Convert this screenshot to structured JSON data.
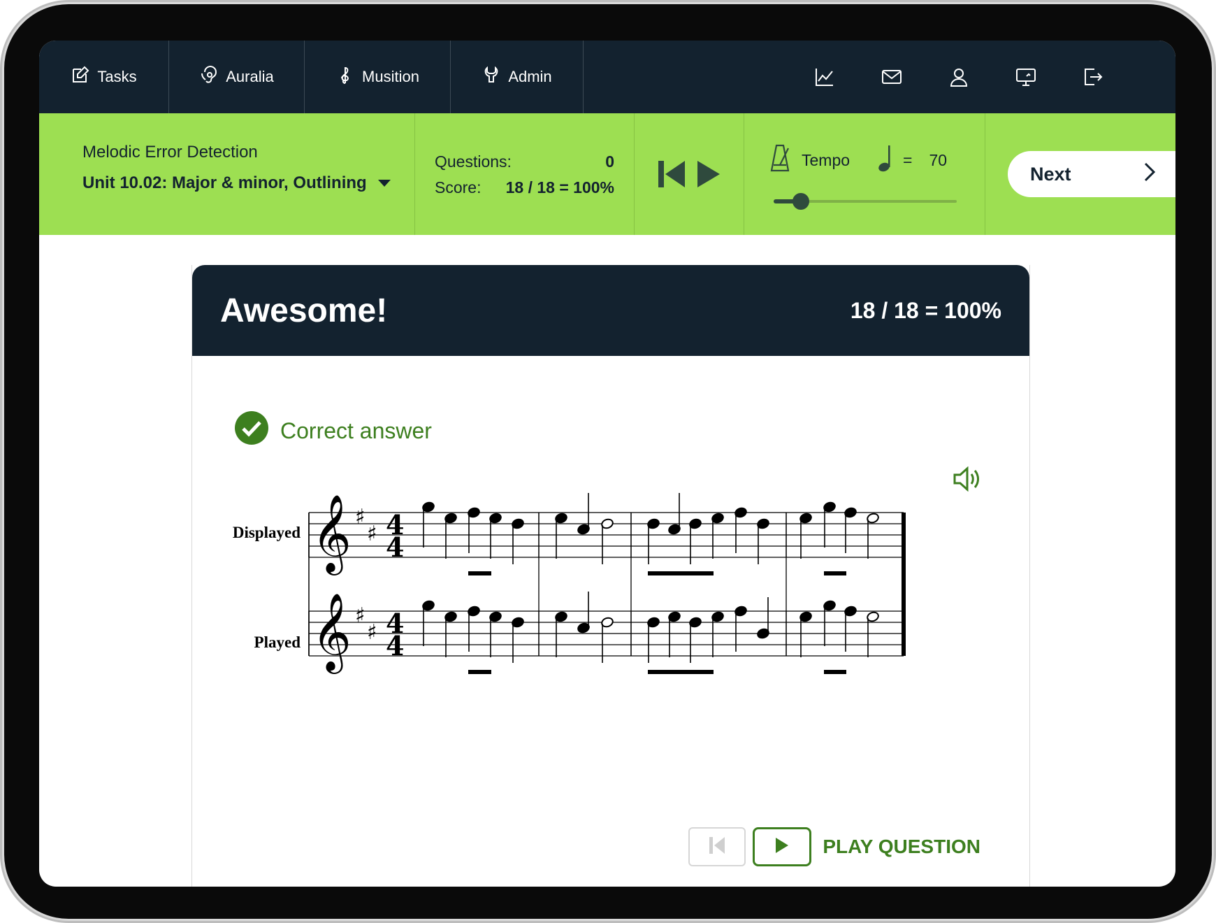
{
  "nav": {
    "tabs": [
      {
        "label": "Tasks",
        "icon": "edit-icon"
      },
      {
        "label": "Auralia",
        "icon": "ear-icon"
      },
      {
        "label": "Musition",
        "icon": "treble-clef-icon"
      },
      {
        "label": "Admin",
        "icon": "wrench-icon"
      }
    ],
    "right_icons": [
      "chart-icon",
      "mail-icon",
      "user-icon",
      "monitor-icon",
      "logout-icon"
    ]
  },
  "toolbar": {
    "exercise_title": "Melodic Error Detection",
    "unit": "Unit 10.02: Major & minor, Outlining",
    "questions_label": "Questions:",
    "questions_value": "0",
    "score_label": "Score:",
    "score_value": "18 / 18 = 100%",
    "tempo_label": "Tempo",
    "tempo_equals": "=",
    "tempo_value": "70",
    "tempo_slider_fraction": 0.15,
    "next_label": "Next"
  },
  "result": {
    "headline": "Awesome!",
    "score": "18 / 18 = 100%",
    "verdict": "Correct answer",
    "staff_labels": [
      "Displayed",
      "Played"
    ],
    "play_label": "PLAY QUESTION"
  },
  "colors": {
    "navy": "#13222f",
    "green_bar": "#9ddf52",
    "correct_green": "#3d7f1f"
  }
}
